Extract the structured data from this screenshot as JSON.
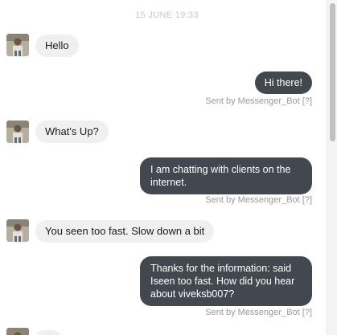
{
  "chat": {
    "date_stamp": "15 JUNE 19:33",
    "messages": [
      {
        "direction": "in",
        "text": "Hello"
      },
      {
        "direction": "out",
        "text": "Hi there!",
        "sent_by": "Sent by Messenger_Bot",
        "help": "[?]"
      },
      {
        "direction": "in",
        "text": "What's Up?"
      },
      {
        "direction": "out",
        "text": "I am chatting with clients on the internet.",
        "sent_by": "Sent by Messenger_Bot",
        "help": "[?]"
      },
      {
        "direction": "in",
        "text": "You seen too fast. Slow down a bit"
      },
      {
        "direction": "out",
        "text": "Thanks for the information: said Iseen too fast.  How did you hear about viveksb007?",
        "sent_by": "Sent by Messenger_Bot",
        "help": "[?]"
      }
    ]
  },
  "colors": {
    "incoming_bubble": "#f0f0f0",
    "outgoing_bubble": "#434850",
    "meta_text": "#9a9a9a"
  },
  "icons": {
    "avatar": "user-avatar-icon"
  }
}
